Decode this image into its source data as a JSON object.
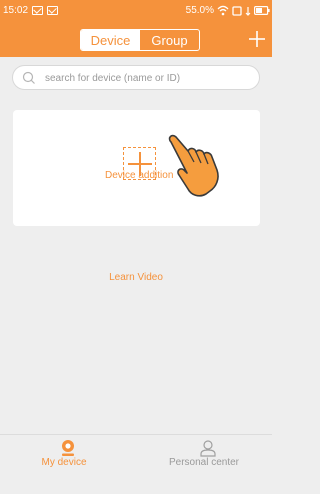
{
  "statusbar": {
    "time": "15:02",
    "battery_text": "55.0%",
    "icons": [
      "message-icon",
      "message-icon",
      "wifi-icon",
      "screen-icon",
      "battery-icon"
    ]
  },
  "header": {
    "tabs": [
      {
        "label": "Device",
        "active": true
      },
      {
        "label": "Group",
        "active": false
      }
    ],
    "add_icon": "plus-icon"
  },
  "search": {
    "placeholder": "search for device (name or ID)",
    "value": ""
  },
  "device_card": {
    "add_label": "Device addition",
    "icons": [
      "plus-icon",
      "hand-pointer-icon"
    ]
  },
  "learn_video_label": "Learn Video",
  "bottom_nav": {
    "items": [
      {
        "label": "My device",
        "icon": "camera-icon",
        "active": true
      },
      {
        "label": "Personal center",
        "icon": "person-icon",
        "active": false
      }
    ]
  },
  "colors": {
    "accent": "#f5923c",
    "background": "#eeeeee",
    "card": "#ffffff",
    "inactive_text": "#9a9a9a"
  }
}
